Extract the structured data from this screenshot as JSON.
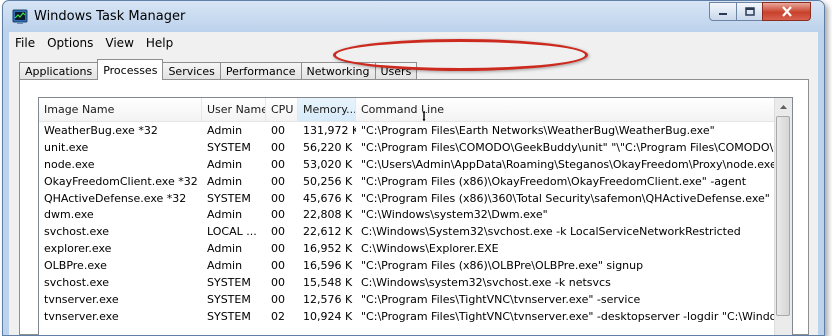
{
  "window": {
    "title": "Windows Task Manager",
    "icon": "task-manager-icon"
  },
  "menu": [
    "File",
    "Options",
    "View",
    "Help"
  ],
  "tabs": [
    "Applications",
    "Processes",
    "Services",
    "Performance",
    "Networking",
    "Users"
  ],
  "active_tab": "Processes",
  "columns": [
    "Image Name",
    "User Name",
    "CPU",
    "Memory...",
    "Command Line"
  ],
  "rows": [
    {
      "name": "WeatherBug.exe *32",
      "user": "Admin",
      "cpu": "00",
      "mem": "131,972 K",
      "cmd": "\"C:\\Program Files\\Earth Networks\\WeatherBug\\WeatherBug.exe\""
    },
    {
      "name": "unit.exe",
      "user": "SYSTEM",
      "cpu": "00",
      "mem": "56,220 K",
      "cmd": "\"C:\\Program Files\\COMODO\\GeekBuddy\\unit\"  \"\\\"C:\\Program Files\\COMODO\\GeekBud"
    },
    {
      "name": "node.exe",
      "user": "Admin",
      "cpu": "00",
      "mem": "53,020 K",
      "cmd": "\"C:\\Users\\Admin\\AppData\\Roaming\\Steganos\\OkayFreedom\\Proxy\\node.exe\" \"C:\\Us"
    },
    {
      "name": "OkayFreedomClient.exe *32",
      "user": "Admin",
      "cpu": "00",
      "mem": "50,256 K",
      "cmd": "\"C:\\Program Files (x86)\\OkayFreedom\\OkayFreedomClient.exe\" -agent"
    },
    {
      "name": "QHActiveDefense.exe *32",
      "user": "SYSTEM",
      "cpu": "00",
      "mem": "45,676 K",
      "cmd": "\"C:\\Program Files (x86)\\360\\Total Security\\safemon\\QHActiveDefense.exe\""
    },
    {
      "name": "dwm.exe",
      "user": "Admin",
      "cpu": "00",
      "mem": "22,808 K",
      "cmd": "\"C:\\Windows\\system32\\Dwm.exe\""
    },
    {
      "name": "svchost.exe",
      "user": "LOCAL ...",
      "cpu": "00",
      "mem": "22,612 K",
      "cmd": "C:\\Windows\\System32\\svchost.exe -k LocalServiceNetworkRestricted"
    },
    {
      "name": "explorer.exe",
      "user": "Admin",
      "cpu": "00",
      "mem": "16,952 K",
      "cmd": "C:\\Windows\\Explorer.EXE"
    },
    {
      "name": "OLBPre.exe",
      "user": "Admin",
      "cpu": "00",
      "mem": "16,596 K",
      "cmd": "\"C:\\Program Files (x86)\\OLBPre\\OLBPre.exe\" signup"
    },
    {
      "name": "svchost.exe",
      "user": "SYSTEM",
      "cpu": "00",
      "mem": "15,548 K",
      "cmd": "C:\\Windows\\system32\\svchost.exe -k netsvcs"
    },
    {
      "name": "tvnserver.exe",
      "user": "SYSTEM",
      "cpu": "00",
      "mem": "12,576 K",
      "cmd": "\"C:\\Program Files\\TightVNC\\tvnserver.exe\" -service"
    },
    {
      "name": "tvnserver.exe",
      "user": "SYSTEM",
      "cpu": "02",
      "mem": "10,924 K",
      "cmd": "\"C:\\Program Files\\TightVNC\\tvnserver.exe\" -desktopserver -logdir \"C:\\Windows\\syst"
    }
  ],
  "colors": {
    "highlight_ring": "#cc2a1e",
    "close_button": "#c8412b",
    "window_frame": "#bcd3ee"
  }
}
